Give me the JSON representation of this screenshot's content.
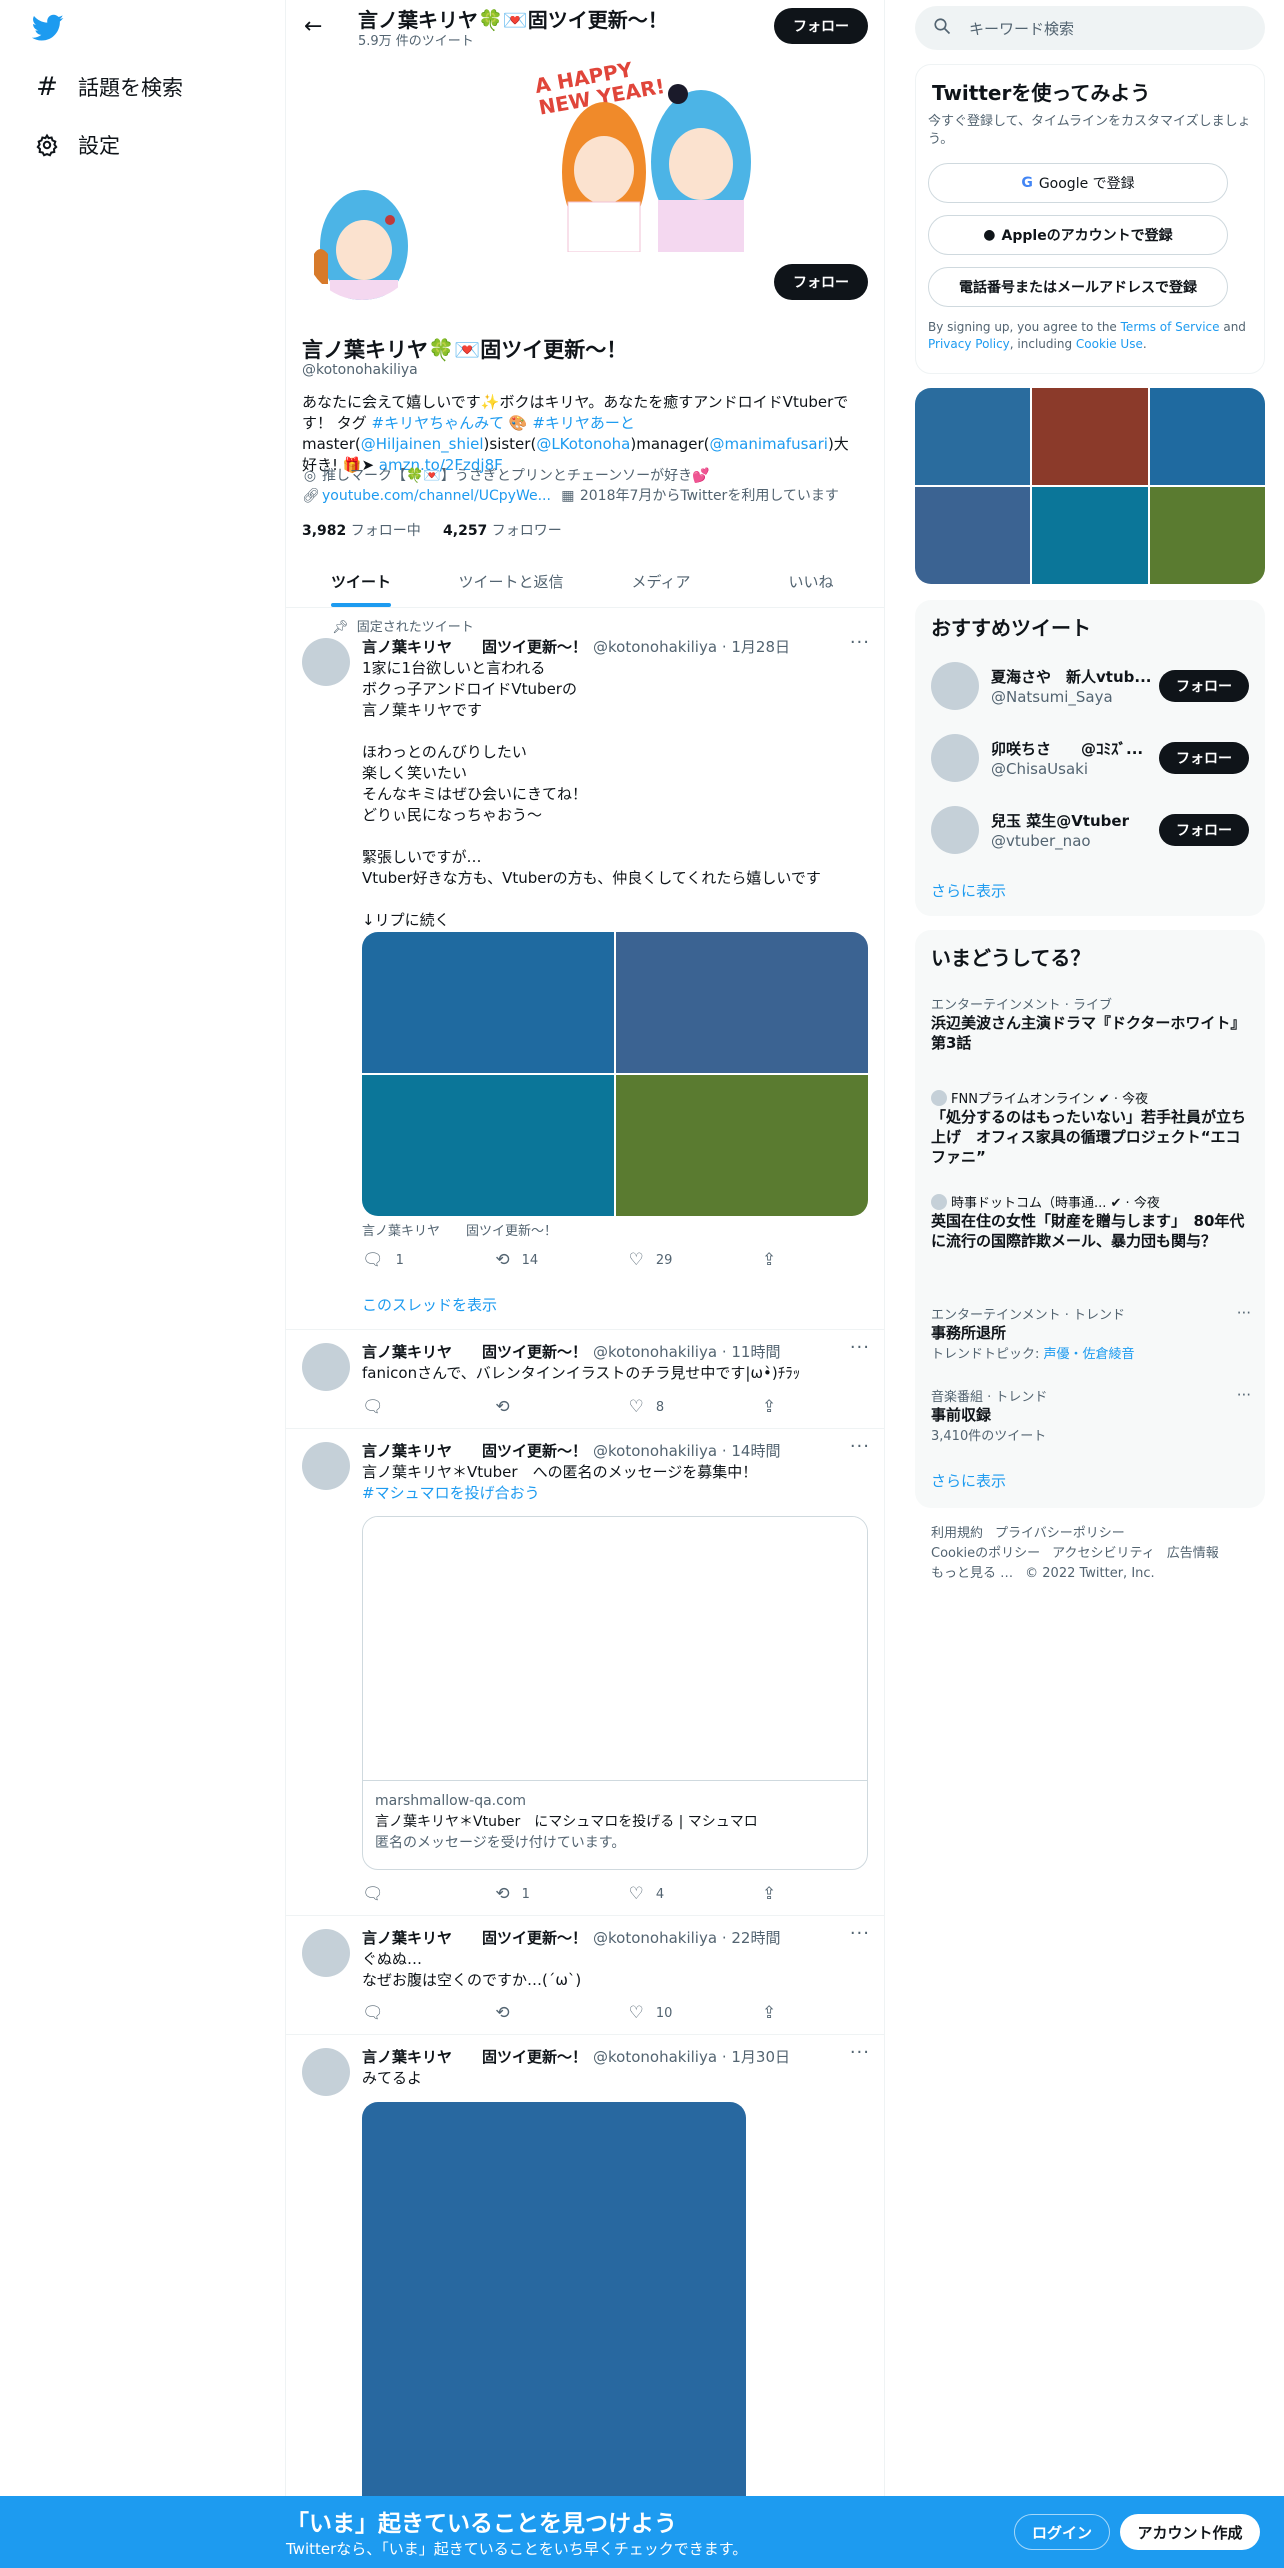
{
  "nav": {
    "explore": "話題を検索",
    "settings": "設定"
  },
  "profile": {
    "name": "言ノ葉キリヤ🍀💌固ツイ更新～！",
    "tweets_count": "5.9万 件のツイート",
    "follow_label": "フォロー",
    "banner_text": "A HAPPY\nNEW YEAR!",
    "handle": "@kotonohakiliya",
    "bio_1": "あなたに会えて嬉しいです✨ボクはキリヤ。あなたを癒すアンドロイドVtuberです！ タグ ",
    "bio_tag1": "#キリヤちゃんみて",
    "bio_2": " 🎨 ",
    "bio_tag2": "#キリヤあーと",
    "bio_3": " master(",
    "bio_master": "@Hiljainen_shiel",
    "bio_4": ")sister(",
    "bio_sister": "@LKotonoha",
    "bio_5": ")manager(",
    "bio_manager": "@manimafusari",
    "bio_6": ")大好き! 🎁➤ ",
    "bio_link": "amzn.to/2Fzdj8F",
    "location": "推しマーク【🍀💌】うさぎとプリンとチェーンソーが好き💕",
    "url": "youtube.com/channel/UCpyWe...",
    "joined": "2018年7月からTwitterを利用しています",
    "following_count": "3,982",
    "following_label": "フォロー中",
    "followers_count": "4,257",
    "followers_label": "フォロワー"
  },
  "tabs": [
    "ツイート",
    "ツイートと返信",
    "メディア",
    "いいね"
  ],
  "tweets": [
    {
      "pinned_label": "固定されたツイート",
      "name": "言ノ葉キリヤ　　固ツイ更新～！",
      "handle": "@kotonohakiliya",
      "time": "· 1月28日",
      "text": "1家に1台欲しいと言われる\nボクっ子アンドロイドVtuberの\n言ノ葉キリヤです\n\nほわっとのんびりしたい\n楽しく笑いたい\nそんなキミはぜひ会いにきてね！\nどりぃ民になっちゃおう～\n\n緊張しいですが…\nVtuber好きな方も、Vtuberの方も、仲良くしてくれたら嬉しいです\n\n↓リプに続く",
      "media_caption": "言ノ葉キリヤ　　固ツイ更新～！",
      "reply": "1",
      "retweet": "14",
      "like": "29",
      "thread_label": "このスレッドを表示"
    },
    {
      "name": "言ノ葉キリヤ　　固ツイ更新～！",
      "handle": "@kotonohakiliya",
      "time": "· 11時間",
      "text": "faniconさんで、バレンタインイラストのチラ見せ中です|ω•̀)ﾁﾗｯ",
      "reply": "",
      "retweet": "",
      "like": "8"
    },
    {
      "name": "言ノ葉キリヤ　　固ツイ更新～！",
      "handle": "@kotonohakiliya",
      "time": "· 14時間",
      "text": "言ノ葉キリヤ＊Vtuber　への匿名のメッセージを募集中！",
      "tag": "#マシュマロを投げ合おう",
      "card_domain": "marshmallow-qa.com",
      "card_title": "言ノ葉キリヤ＊Vtuber　にマシュマロを投げる | マシュマロ",
      "card_desc": "匿名のメッセージを受け付けています。",
      "reply": "",
      "retweet": "1",
      "like": "4"
    },
    {
      "name": "言ノ葉キリヤ　　固ツイ更新～！",
      "handle": "@kotonohakiliya",
      "time": "· 22時間",
      "text": "ぐぬぬ…\nなぜお腹は空くのですか…(´ω`)",
      "reply": "",
      "retweet": "",
      "like": "10"
    },
    {
      "name": "言ノ葉キリヤ　　固ツイ更新～！",
      "handle": "@kotonohakiliya",
      "time": "· 1月30日",
      "text": "みてるよ"
    }
  ],
  "search": {
    "placeholder": "キーワード検索"
  },
  "signup": {
    "title": "Twitterを使ってみよう",
    "desc": "今すぐ登録して、タイムラインをカスタマイズしましょう。",
    "google": "Google で登録",
    "apple": "Appleのアカウントで登録",
    "phone": "電話番号またはメールアドレスで登録",
    "terms_1": "By signing up, you agree to the ",
    "terms_tos": "Terms of Service",
    "terms_2": " and ",
    "terms_privacy": "Privacy Policy",
    "terms_3": ", including ",
    "terms_cookie": "Cookie Use",
    "terms_4": "."
  },
  "who_to_follow": {
    "title": "おすすめツイート",
    "users": [
      {
        "name": "夏海さや　新人vtub...",
        "handle": "@Natsumi_Saya"
      },
      {
        "name": "卯咲ちさ　　@ｺﾐｽﾞ...",
        "handle": "@ChisaUsaki"
      },
      {
        "name": "兒玉 菜生@Vtuber",
        "handle": "@vtuber_nao"
      }
    ],
    "follow_label": "フォロー",
    "more": "さらに表示"
  },
  "trends": {
    "title": "いまどうしてる？",
    "items": [
      {
        "cat": "エンターテインメント · ライブ",
        "title": "浜辺美波さん主演ドラマ『ドクターホワイト』第3話"
      },
      {
        "cat": "FNNプライムオンライン ✔ · 今夜",
        "title": "「処分するのはもったいない」若手社員が立ち上げ　オフィス家具の循環プロジェクト“エコファニ”"
      },
      {
        "cat": "時事ドットコム（時事通... ✔ · 今夜",
        "title": "英国在住の女性「財産を贈与します」　80年代に流行の国際詐欺メール、暴力団も関与？"
      },
      {
        "cat": "エンターテインメント · トレンド",
        "title": "事務所退所",
        "sub_1": "トレンドトピック: ",
        "sub_link": "声優・佐倉綾音"
      },
      {
        "cat": "音楽番組 · トレンド",
        "title": "事前収録",
        "sub_1": "3,410件のツイート"
      }
    ],
    "more": "さらに表示"
  },
  "footer": {
    "links": [
      "利用規約",
      "プライバシーポリシー",
      "Cookieのポリシー",
      "アクセシビリティ",
      "広告情報",
      "もっと見る …"
    ],
    "copyright": "© 2022 Twitter, Inc."
  },
  "bottom": {
    "big": "「いま」起きていることを見つけよう",
    "small": "Twitterなら、「いま」起きていることをいち早くチェックできます。",
    "login": "ログイン",
    "signup": "アカウント作成"
  },
  "colors": {
    "accent": "#1d9bf0",
    "media": [
      "#1f6aa0",
      "#3b6392",
      "#0b7699",
      "#5a7b30"
    ],
    "photos": [
      "#2a6c9e",
      "#8b3a2a",
      "#1f6aa0",
      "#3b6392",
      "#0b7699",
      "#5a7b30"
    ]
  }
}
